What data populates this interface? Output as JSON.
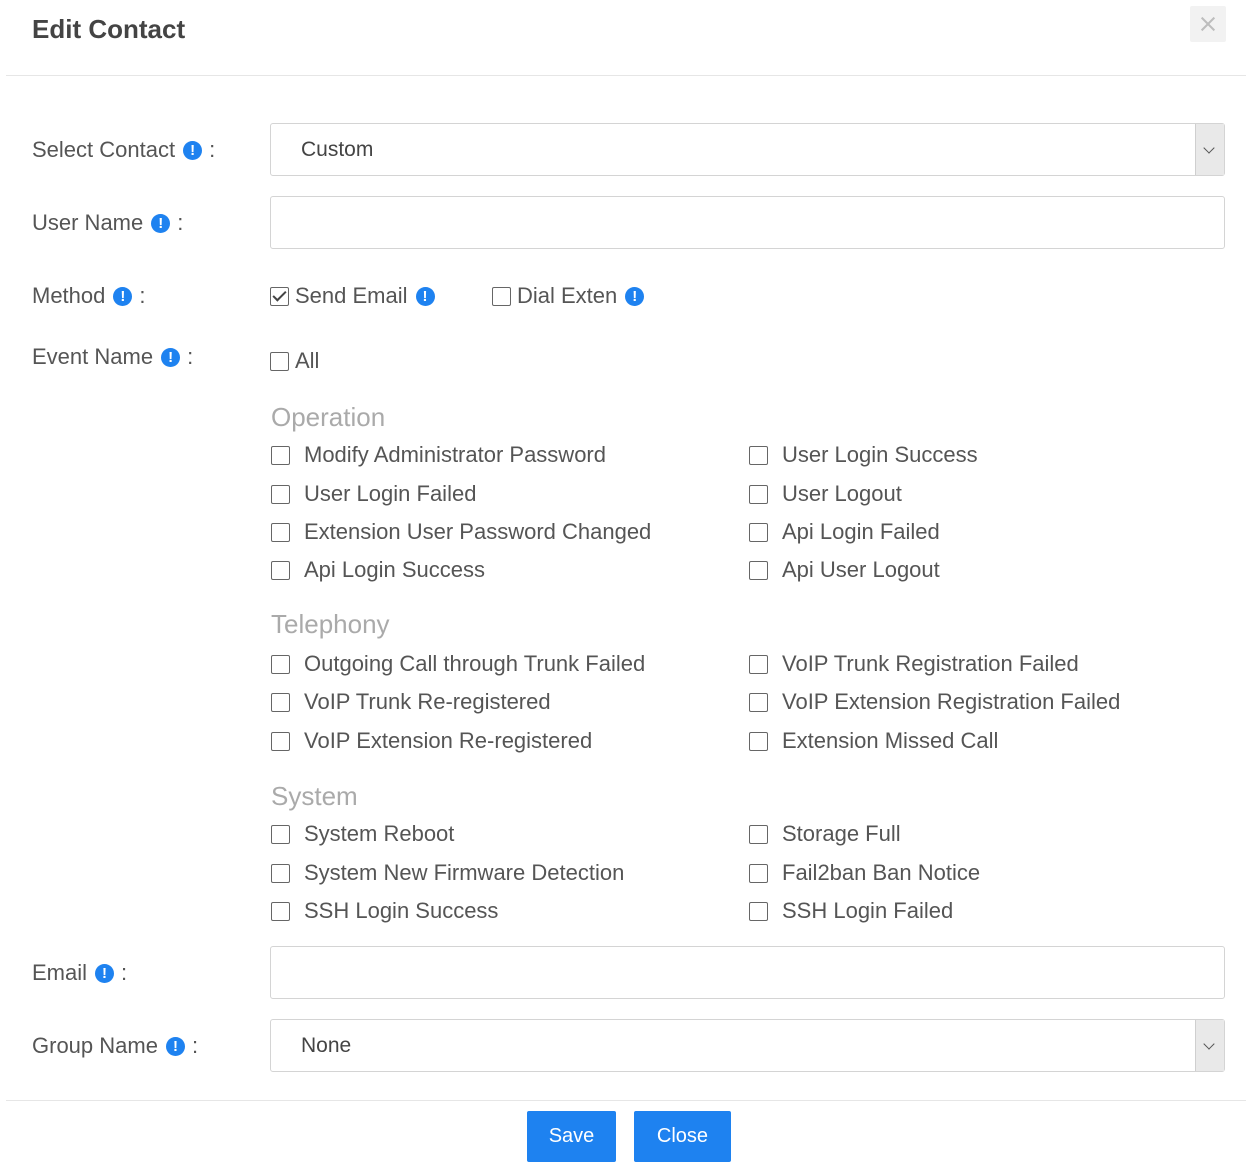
{
  "dialog": {
    "title": "Edit Contact",
    "info_glyph": "!"
  },
  "form": {
    "select_contact": {
      "label": "Select Contact",
      "value": "Custom"
    },
    "user_name": {
      "label": "User Name",
      "value": ""
    },
    "method": {
      "label": "Method",
      "options": [
        {
          "label": "Send Email",
          "checked": true
        },
        {
          "label": "Dial Exten",
          "checked": false
        }
      ]
    },
    "event_name": {
      "label": "Event Name",
      "all_label": "All"
    },
    "email": {
      "label": "Email",
      "value": ""
    },
    "group_name": {
      "label": "Group Name",
      "value": "None"
    }
  },
  "event_groups": [
    {
      "title": "Operation",
      "events": [
        "Modify Administrator Password",
        "User Login Success",
        "User Login Failed",
        "User Logout",
        "Extension User Password Changed",
        "Api Login Failed",
        "Api Login Success",
        "Api User Logout"
      ]
    },
    {
      "title": "Telephony",
      "events": [
        "Outgoing Call through Trunk Failed",
        "VoIP Trunk Registration Failed",
        "VoIP Trunk Re-registered",
        "VoIP Extension Registration Failed",
        "VoIP Extension Re-registered",
        "Extension Missed Call"
      ]
    },
    {
      "title": "System",
      "events": [
        "System Reboot",
        "Storage Full",
        "System New Firmware Detection",
        "Fail2ban Ban Notice",
        "SSH Login Success",
        "SSH Login Failed"
      ]
    }
  ],
  "buttons": {
    "save": "Save",
    "close": "Close"
  },
  "colors": {
    "accent": "#1e82f0",
    "section_title": "#aaaaaa"
  }
}
